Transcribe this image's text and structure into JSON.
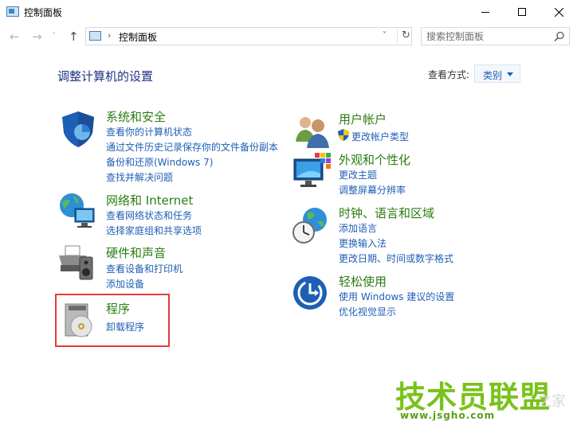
{
  "window": {
    "title": "控制面板",
    "minimize_glyph": "–",
    "maximize_glyph": "□",
    "close_glyph": "✕"
  },
  "nav": {
    "back": "←",
    "forward": "→",
    "dropdown": "˅",
    "up": "↑",
    "separator": "›",
    "address": "控制面板",
    "address_dropdown": "˅",
    "refresh": "↻",
    "search_placeholder": "搜索控制面板"
  },
  "main": {
    "heading": "调整计算机的设置",
    "view_label": "查看方式:",
    "view_value": "类别"
  },
  "left_categories": [
    {
      "title": "系统和安全",
      "icon": "shield-icon",
      "links": [
        "查看你的计算机状态",
        "通过文件历史记录保存你的文件备份副本",
        "备份和还原(Windows 7)",
        "查找并解决问题"
      ]
    },
    {
      "title": "网络和 Internet",
      "icon": "network-globe-icon",
      "links": [
        "查看网络状态和任务",
        "选择家庭组和共享选项"
      ]
    },
    {
      "title": "硬件和声音",
      "icon": "printer-speaker-icon",
      "links": [
        "查看设备和打印机",
        "添加设备"
      ]
    },
    {
      "title": "程序",
      "icon": "programs-disc-icon",
      "links": [
        "卸载程序"
      ]
    }
  ],
  "right_categories": [
    {
      "title": "用户帐户",
      "icon": "users-icon",
      "links": [
        "更改帐户类型"
      ]
    },
    {
      "title": "外观和个性化",
      "icon": "monitor-palette-icon",
      "links": [
        "更改主题",
        "调整屏幕分辨率"
      ]
    },
    {
      "title": "时钟、语言和区域",
      "icon": "clock-globe-icon",
      "links": [
        "添加语言",
        "更换输入法",
        "更改日期、时间或数字格式"
      ]
    },
    {
      "title": "轻松使用",
      "icon": "ease-of-access-icon",
      "links": [
        "使用 Windows 建议的设置",
        "优化视觉显示"
      ]
    }
  ],
  "watermark": {
    "main": "技术员联盟",
    "url": "www.jsgho.com",
    "ghost": "之家"
  },
  "colors": {
    "category_title": "#2c7d13",
    "link": "#1f5fb5",
    "heading": "#1e3287",
    "highlight_border": "#e53b3b",
    "watermark": "#79c21a"
  }
}
